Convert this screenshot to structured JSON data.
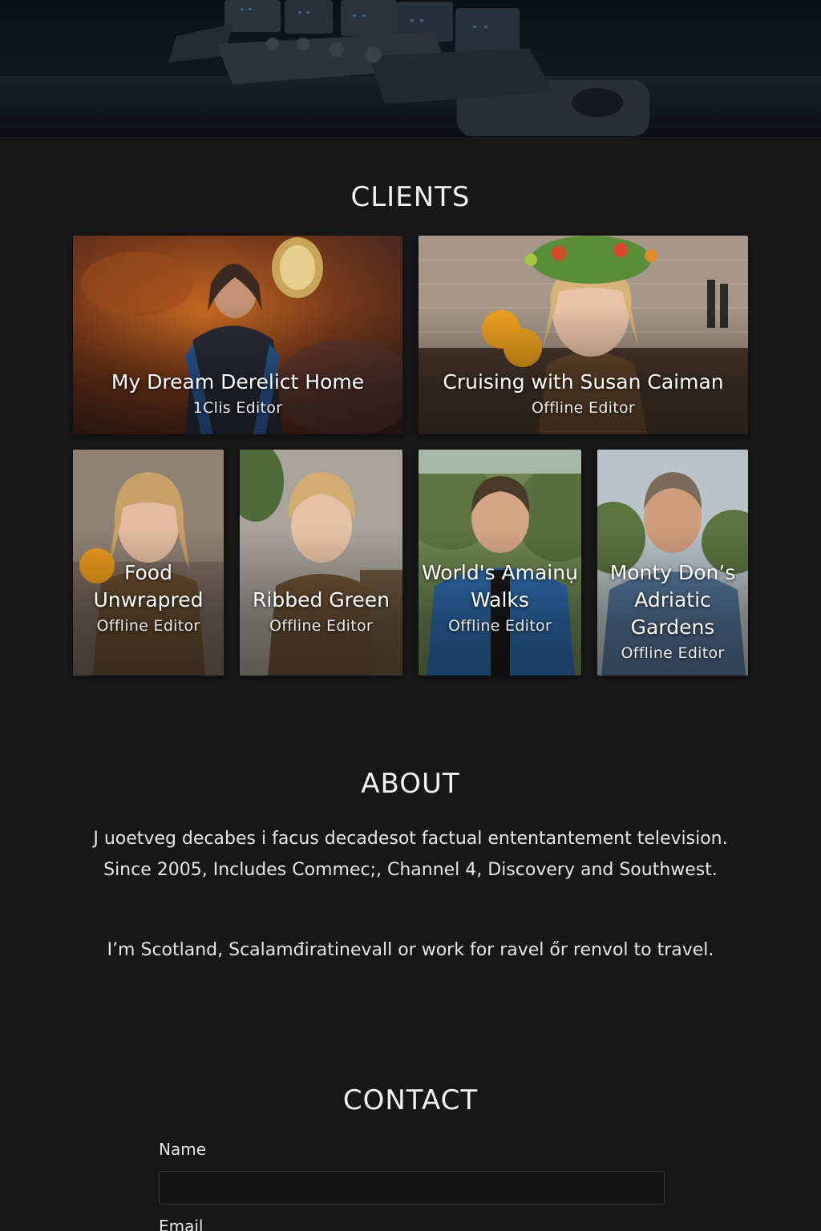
{
  "clients": {
    "title": "CLIENTS",
    "items": [
      {
        "title": "My Dream Derelict Home",
        "role": "1Clis  Editor"
      },
      {
        "title": "Cruising with Susan Caiman",
        "role": "Offline Editor"
      },
      {
        "title": "Food Unwrapred",
        "role": "Offline Editor"
      },
      {
        "title": "Ribbed Green",
        "role": "Offline Editor"
      },
      {
        "title": "World's Amainụ Walks",
        "role": "Offline Editor"
      },
      {
        "title": "Monty Don’s Adriatic Gardens",
        "role": "Offline Editor"
      }
    ]
  },
  "about": {
    "title": "ABOUT",
    "paragraph_1": "J uoetveg decabes i facus decadesot factual ententantement television. Since 2005, Includes Commec;, Channel 4, Discovery and Southwest.",
    "paragraph_2": "I’m Scotland, Scalamđiratinevall or work for ravel őr renvol to travel."
  },
  "contact": {
    "title": "CONTACT",
    "name_label": "Name",
    "name_value": "",
    "email_label": "Email"
  },
  "colors": {
    "background": "#171717",
    "text": "#ffffff",
    "input_border": "#3a3a3a"
  }
}
